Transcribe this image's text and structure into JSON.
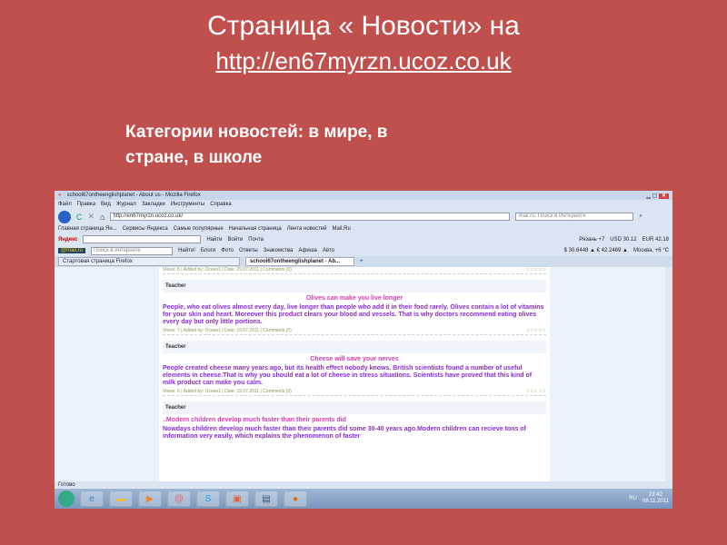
{
  "slide": {
    "title": "Страница « Новости»  на",
    "url": "http://en67myrzn.ucoz.co.uk",
    "categories": "Категории новостей: в мире, в стране, в школе"
  },
  "browser": {
    "window_title": "school67ontheenglishplanet - About us - Mozilla Firefox",
    "menu": [
      "Файл",
      "Правка",
      "Вид",
      "Журнал",
      "Закладки",
      "Инструменты",
      "Справка"
    ],
    "address": "http://en67myrzn.ucoz.co.uk/",
    "search_placeholder": "mail.ru: Поиск в Интернете",
    "bookmarks": [
      "Главная страница Ян...",
      "Сервисы Яндекса",
      "Самые популярные",
      "Начальная страница",
      "Лента новостей",
      "Mail.Ru"
    ],
    "yandex": {
      "logo": "Яндекс",
      "find": "Найти",
      "login": "Войти",
      "mail": "Почта",
      "weather": "Рязань +7",
      "usd": "USD 30.12",
      "eur": "EUR 42.18"
    },
    "mailbar": {
      "logo": "@mail.ru",
      "placeholder": "Поиск в интернете",
      "find": "Найти!",
      "links": [
        "Блоги",
        "Фото",
        "Ответы",
        "Знакомства",
        "Афиша",
        "Авто"
      ],
      "rates": "$ 30.6448 ▲  € 42.2469 ▲",
      "weather": "Москва, +6 °C"
    },
    "tabs": [
      "Стартовая страница Firefox",
      "school67ontheenglishplanet - Ab..."
    ],
    "status": "Готово",
    "clock": {
      "lang": "RU",
      "time": "23:42",
      "date": "08.11.2011"
    }
  },
  "posts_meta_top": {
    "info": "Views: 8 | Added by: Ocean1 | Date: 29.07.2011 | Comments (0)"
  },
  "posts": [
    {
      "category": "Teacher",
      "title": "Olives can make you live longer",
      "body": "People, who eat olives almost every day,  live longer than people who   add it in their food rarely. Olives contain a lot of vitamins for your skin and heart. Moreover this product clears your blood and vessels. That is why doctors recommend eating olives every day but only little portions.",
      "info": "Views: 7 | Added by: Ocean1 | Date: 15.07.2011 | Comments (0)"
    },
    {
      "category": "Teacher",
      "title": "Cheese will save your nerves",
      "body": "People created cheese many years ago, but its health effect nobody knows. British scientists found a number of useful elements in cheese.That is why you should eat a lot of cheese in stress situations. Scientists  have proved that this kind of milk product can make you calm.",
      "info": "Views: 6 | Added by: Ocean1 | Date: 15.07.2011 | Comments (0)"
    },
    {
      "category": "Teacher",
      "title": "..Modern children  develop much faster than their parents did",
      "body": "Nowdays children develop much faster than their  parents did some 30-40 years ago.Modern children  can recieve tons of information very easily, which explains the phenomenon of faster"
    }
  ],
  "rating": "☆☆☆☆☆"
}
